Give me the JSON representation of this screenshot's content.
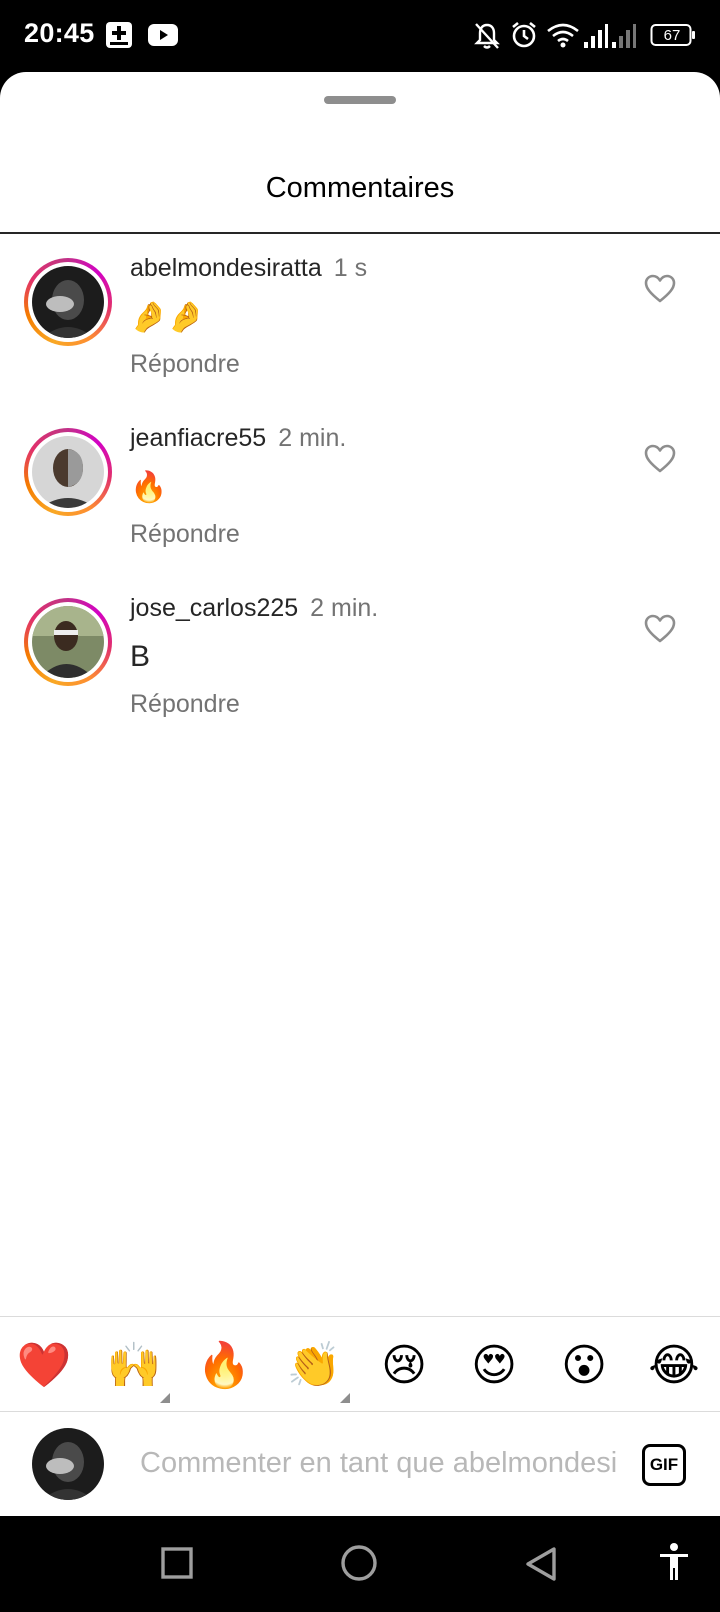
{
  "status_bar": {
    "time": "20:45",
    "battery": "67",
    "icons": [
      "plus-box-icon",
      "youtube-icon",
      "bell-off-icon",
      "alarm-icon",
      "wifi-icon",
      "signal-icon",
      "signal-icon",
      "battery-icon"
    ]
  },
  "sheet": {
    "title": "Commentaires"
  },
  "comments": [
    {
      "username": "abelmondesiratta",
      "time": "1 s",
      "text": "🤌🤌",
      "reply_label": "Répondre",
      "avatar_color": "#2a2a2a"
    },
    {
      "username": "jeanfiacre55",
      "time": "2 min.",
      "text": "🔥",
      "reply_label": "Répondre",
      "avatar_color": "#9e9e9e"
    },
    {
      "username": "jose_carlos225",
      "time": "2 min.",
      "text": "B",
      "reply_label": "Répondre",
      "avatar_color": "#6d7b5a"
    }
  ],
  "emoji_bar": [
    "❤️",
    "🙌",
    "🔥",
    "👏",
    "😢",
    "😍",
    "😮",
    "😂"
  ],
  "input": {
    "placeholder": "Commenter en tant que abelmondesiratta",
    "gif_label": "GIF"
  },
  "nav_bar": {
    "icons": [
      "recents-square-icon",
      "home-circle-icon",
      "back-triangle-icon",
      "accessibility-icon"
    ]
  },
  "colors": {
    "text": "#262626",
    "secondary": "#737373",
    "ring_start": "#f9a825",
    "ring_end": "#d300c5"
  }
}
